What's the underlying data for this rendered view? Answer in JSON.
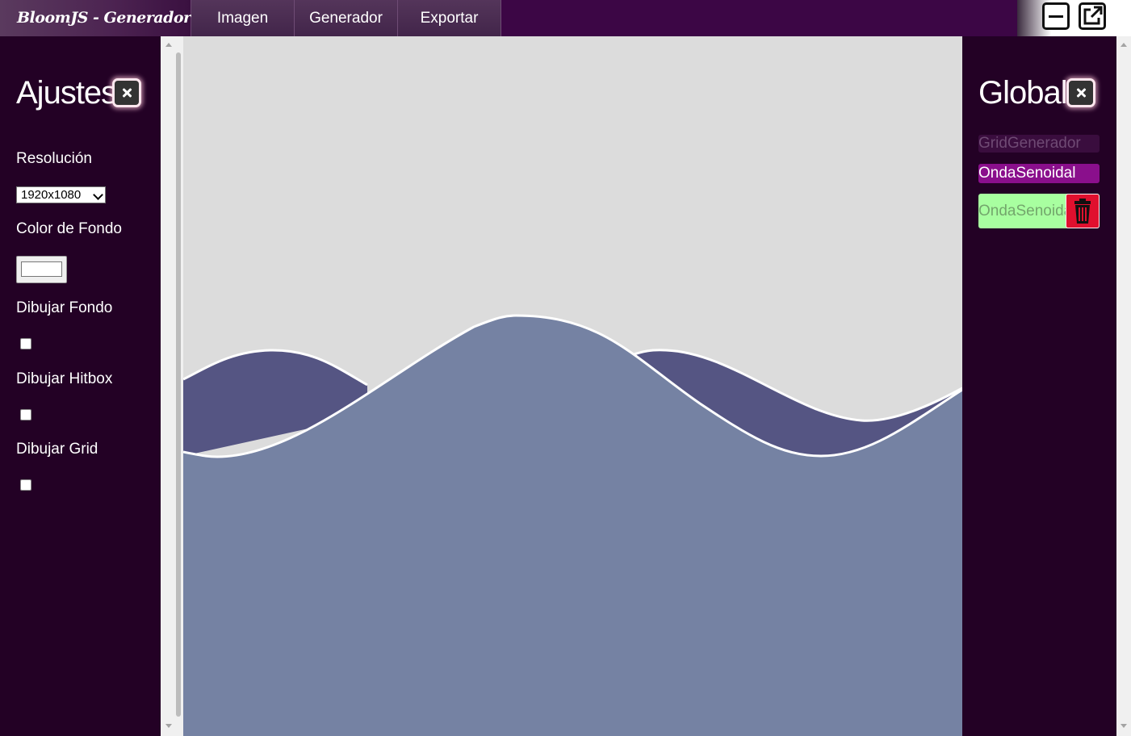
{
  "app": {
    "brand": "BloomJS - Generador"
  },
  "menu": {
    "items": [
      "Imagen",
      "Generador",
      "Exportar"
    ]
  },
  "window_controls": {
    "minimize_icon": "minimize-icon",
    "popout_icon": "external-link-icon"
  },
  "settings_panel": {
    "title": "Ajustes",
    "resolution_label": "Resolución",
    "resolution_value": "1920x1080",
    "bg_color_label": "Color de Fondo",
    "bg_color_value": "#ffffff",
    "draw_bg_label": "Dibujar Fondo",
    "draw_bg_checked": false,
    "draw_hitbox_label": "Dibujar Hitbox",
    "draw_hitbox_checked": false,
    "draw_grid_label": "Dibujar Grid",
    "draw_grid_checked": false
  },
  "global_panel": {
    "title": "Global",
    "layers": [
      "GridGenerador",
      "OndaSenoidal",
      "OndaSenoidal"
    ]
  },
  "colors": {
    "topbar": "#3c0645",
    "panel_bg": "#230125",
    "canvas_bg": "#dcdcdc",
    "wave_back": "#555583",
    "wave_front": "#7582a3",
    "wave_stroke": "#ffffff",
    "layer_selected": "#8a0f8c",
    "layer_hover": "#a8ffa0",
    "delete": "#e0102e"
  }
}
